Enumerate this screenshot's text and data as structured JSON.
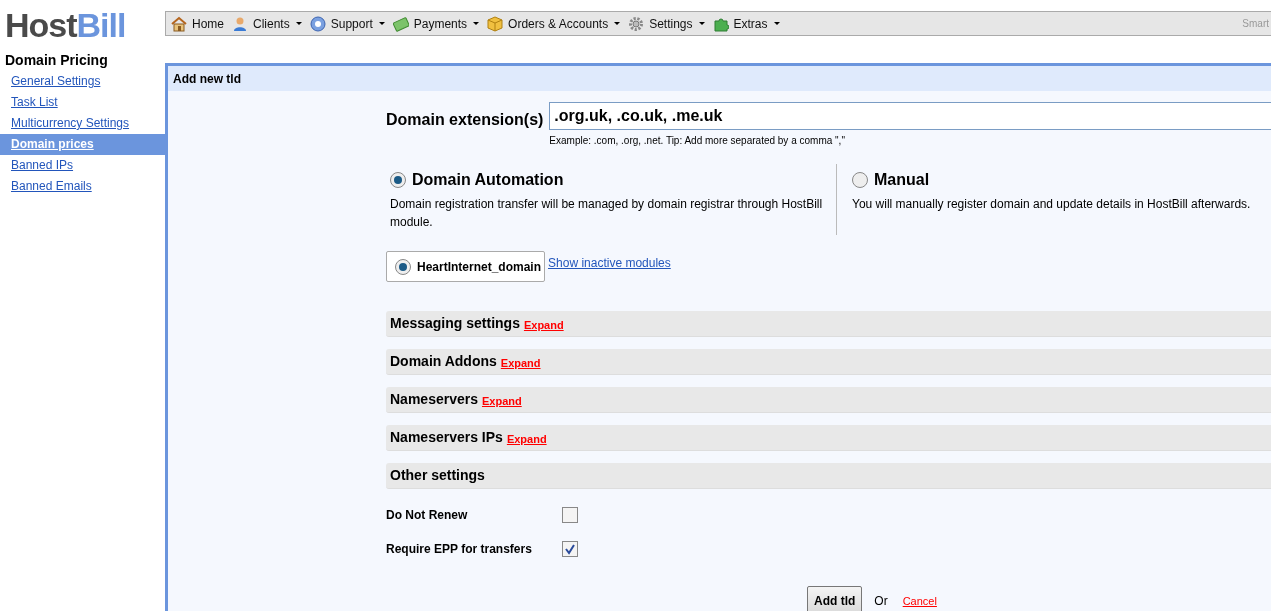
{
  "logo": {
    "part1": "Host",
    "part2": "Bill"
  },
  "sidebar": {
    "title": "Domain Pricing",
    "items": [
      {
        "label": "General Settings",
        "selected": false
      },
      {
        "label": "Task List",
        "selected": false
      },
      {
        "label": "Multicurrency Settings",
        "selected": false
      },
      {
        "label": "Domain prices",
        "selected": true
      },
      {
        "label": "Banned IPs",
        "selected": false
      },
      {
        "label": "Banned Emails",
        "selected": false
      }
    ]
  },
  "menu": [
    {
      "label": "Home",
      "dropdown": false
    },
    {
      "label": "Clients",
      "dropdown": true
    },
    {
      "label": "Support",
      "dropdown": true
    },
    {
      "label": "Payments",
      "dropdown": true
    },
    {
      "label": "Orders & Accounts",
      "dropdown": true
    },
    {
      "label": "Settings",
      "dropdown": true
    },
    {
      "label": "Extras",
      "dropdown": true
    }
  ],
  "menu_right": "Smart",
  "panel": {
    "title": "Add new tld"
  },
  "extension": {
    "label": "Domain extension(s)",
    "value": ".org.uk, .co.uk, .me.uk",
    "hint": "Example: .com, .org, .net. Tip: Add more separated by a comma \",\""
  },
  "modes": [
    {
      "title": "Domain Automation",
      "description": "Domain registration transfer will be managed by domain registrar through HostBill module.",
      "selected": true
    },
    {
      "title": "Manual",
      "description": "You will manually register domain and update details in HostBill afterwards.",
      "selected": false
    }
  ],
  "modules": [
    {
      "label": "HeartInternet_domain",
      "selected": true
    }
  ],
  "show_inactive": "Show inactive modules",
  "sections": [
    {
      "title": "Messaging settings",
      "expand": "Expand"
    },
    {
      "title": "Domain Addons",
      "expand": "Expand"
    },
    {
      "title": "Nameservers",
      "expand": "Expand"
    },
    {
      "title": "Nameservers IPs",
      "expand": "Expand"
    },
    {
      "title": "Other settings"
    }
  ],
  "options": [
    {
      "label": "Do Not Renew",
      "checked": false
    },
    {
      "label": "Require EPP for transfers",
      "checked": true
    }
  ],
  "submit": "Add tld",
  "or": "Or",
  "cancel": "Cancel"
}
